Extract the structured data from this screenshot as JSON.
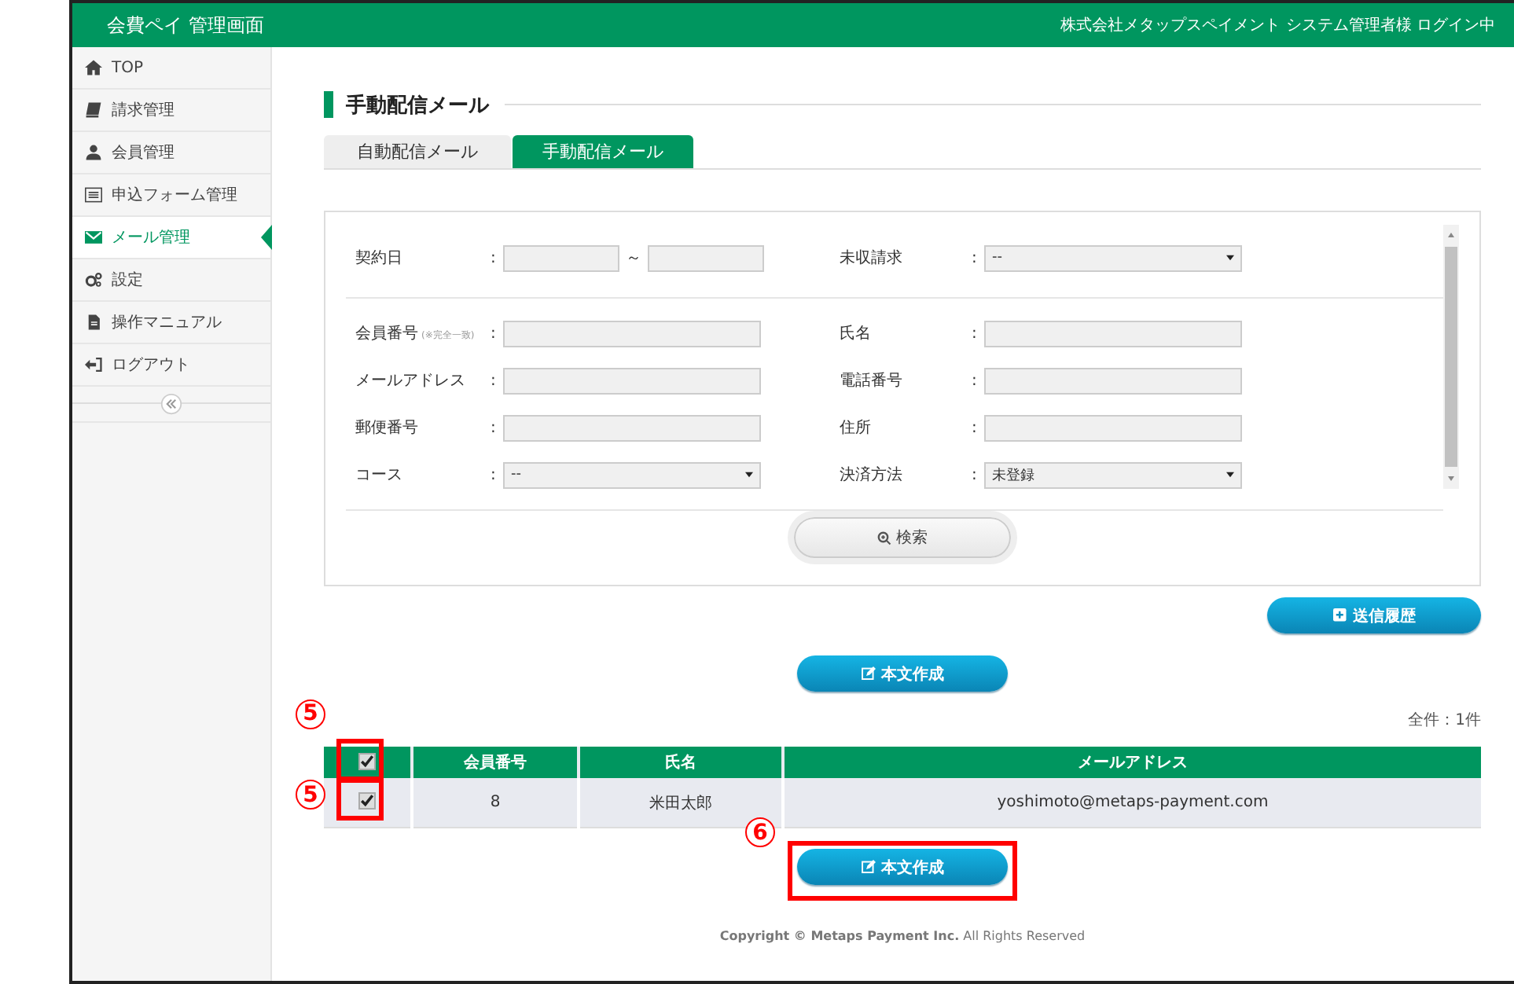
{
  "header": {
    "title": "会費ペイ 管理画面",
    "user": "株式会社メタップスペイメント システム管理者様 ログイン中"
  },
  "sidebar": {
    "items": [
      {
        "label": "TOP",
        "selected": false
      },
      {
        "label": "請求管理",
        "selected": false
      },
      {
        "label": "会員管理",
        "selected": false
      },
      {
        "label": "申込フォーム管理",
        "selected": false
      },
      {
        "label": "メール管理",
        "selected": true
      },
      {
        "label": "設定",
        "selected": false
      },
      {
        "label": "操作マニュアル",
        "selected": false
      },
      {
        "label": "ログアウト",
        "selected": false
      }
    ]
  },
  "heading": "手動配信メール",
  "tabs": [
    {
      "label": "自動配信メール",
      "selected": false
    },
    {
      "label": "手動配信メール",
      "selected": true
    }
  ],
  "search_form": {
    "sections": [
      {
        "rows": [
          {
            "left": {
              "label": "契約日",
              "kind": "range",
              "separator": "～"
            },
            "right": {
              "label": "未収請求",
              "kind": "select",
              "value": "--"
            }
          }
        ]
      },
      {
        "rows": [
          {
            "left": {
              "label": "会員番号",
              "note": "(※完全一致)",
              "kind": "text"
            },
            "right": {
              "label": "氏名",
              "kind": "text"
            }
          },
          {
            "left": {
              "label": "メールアドレス",
              "kind": "text"
            },
            "right": {
              "label": "電話番号",
              "kind": "text"
            }
          },
          {
            "left": {
              "label": "郵便番号",
              "kind": "text"
            },
            "right": {
              "label": "住所",
              "kind": "text"
            }
          },
          {
            "left": {
              "label": "コース",
              "kind": "select",
              "value": "--"
            },
            "right": {
              "label": "決済方法",
              "kind": "select",
              "value": "未登録"
            }
          }
        ]
      }
    ],
    "colon": ":",
    "search_button": "検索"
  },
  "history_button": "送信履歴",
  "compose_buttons": [
    {
      "label": "本文作成"
    },
    {
      "label": "本文作成",
      "callout": "6"
    }
  ],
  "total": "全件：1件",
  "table": {
    "select_all": {
      "checked": true,
      "callout": "5"
    },
    "columns": [
      "会員番号",
      "氏名",
      "メールアドレス"
    ],
    "rows": [
      {
        "checked": true,
        "callout": "5",
        "cells": [
          "8",
          "米田太郎",
          "yoshimoto@metaps-payment.com"
        ]
      }
    ]
  },
  "footer": "**Copyright © Metaps Payment Inc.** All Rights Reserved"
}
